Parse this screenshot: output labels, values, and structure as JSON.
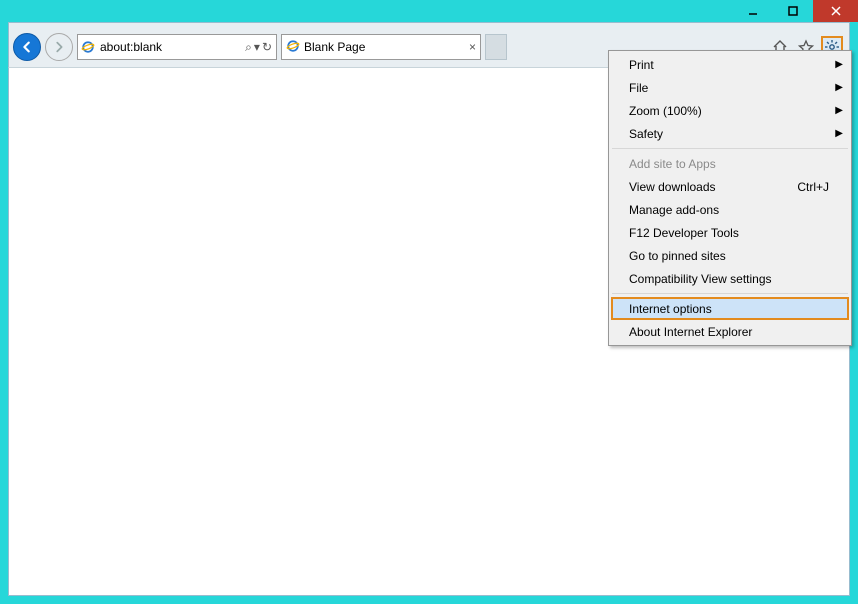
{
  "titlebar": {
    "minimize": "−",
    "maximize": "▢",
    "close": "×"
  },
  "address": {
    "url": "about:blank",
    "search_tip": "⌕",
    "dropdown": "▾",
    "refresh": "↻"
  },
  "tab": {
    "title": "Blank Page",
    "close": "×"
  },
  "menu": {
    "print": "Print",
    "file": "File",
    "zoom": "Zoom (100%)",
    "safety": "Safety",
    "add_site": "Add site to Apps",
    "downloads": "View downloads",
    "downloads_sc": "Ctrl+J",
    "addons": "Manage add-ons",
    "f12": "F12 Developer Tools",
    "pinned": "Go to pinned sites",
    "compat": "Compatibility View settings",
    "inetopt": "Internet options",
    "about": "About Internet Explorer"
  }
}
